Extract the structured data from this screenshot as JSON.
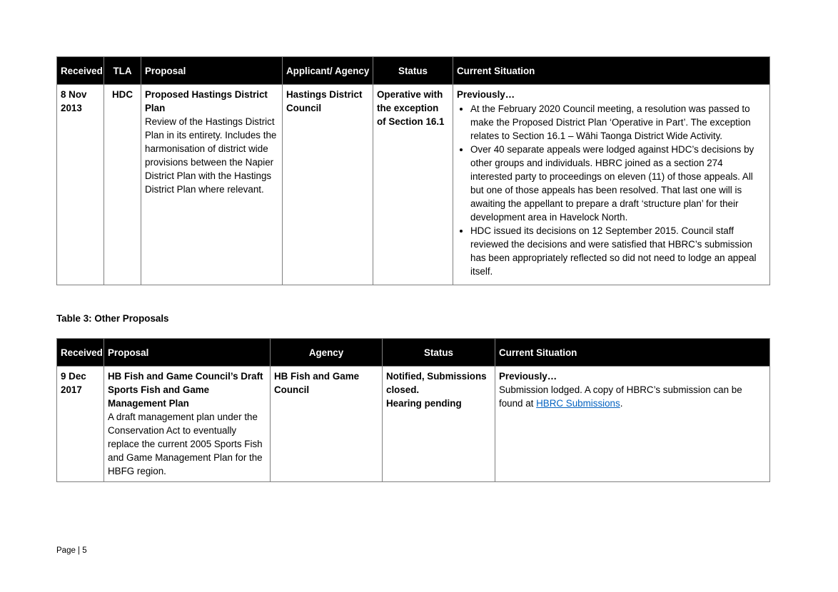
{
  "table1": {
    "headers": {
      "received": "Received",
      "tla": "TLA",
      "proposal": "Proposal",
      "applicant": "Applicant/ Agency",
      "status": "Status",
      "situation": "Current Situation"
    },
    "row": {
      "received": "8 Nov 2013",
      "tla": "HDC",
      "proposal_title": "Proposed Hastings District Plan",
      "proposal_desc": "Review of the Hastings District Plan in its entirety.  Includes the harmonisation of district wide provisions between the Napier District Plan with the Hastings District Plan where relevant.",
      "applicant": "Hastings District Council",
      "status": "Operative with the exception of Section 16.1",
      "situation_heading": "Previously…",
      "situation_bullets": [
        "At the February 2020 Council meeting, a resolution was passed to make the Proposed District Plan ‘Operative in Part’.  The exception relates to Section 16.1 – Wāhi Taonga District Wide Activity.",
        "Over 40 separate appeals were lodged against HDC’s decisions by other groups and individuals.  HBRC joined as a section 274 interested party to proceedings on eleven (11) of those appeals.  All but one of those appeals has been resolved.  That last one will is awaiting the appellant to prepare a draft ‘structure plan’ for their development area in Havelock North.",
        "HDC issued its decisions on 12 September 2015.  Council staff reviewed the decisions and were satisfied that HBRC’s submission has been appropriately reflected so did not need to lodge an appeal itself."
      ]
    }
  },
  "caption": "Table 3: Other Proposals",
  "table2": {
    "headers": {
      "received": "Received",
      "proposal": "Proposal",
      "agency": "Agency",
      "status": "Status",
      "situation": "Current Situation"
    },
    "row": {
      "received": "9 Dec 2017",
      "proposal_title": "HB Fish and Game Council’s Draft Sports Fish and Game Management Plan",
      "proposal_desc": "A draft management plan under the Conservation Act to eventually replace the current 2005 Sports Fish and Game Management Plan for the HBFG region.",
      "agency": "HB Fish and Game Council",
      "status_line1": "Notified, Submissions closed.",
      "status_line2": "Hearing pending",
      "situation_heading": "Previously…",
      "situation_text": "Submission lodged. A copy of HBRC’s submission can be found at ",
      "situation_link": "HBRC Submissions",
      "situation_end": "."
    }
  },
  "footer": "Page | 5",
  "colors": {
    "header_bg": "#000000",
    "link": "#0563c1",
    "border": "#7f7f7f"
  }
}
